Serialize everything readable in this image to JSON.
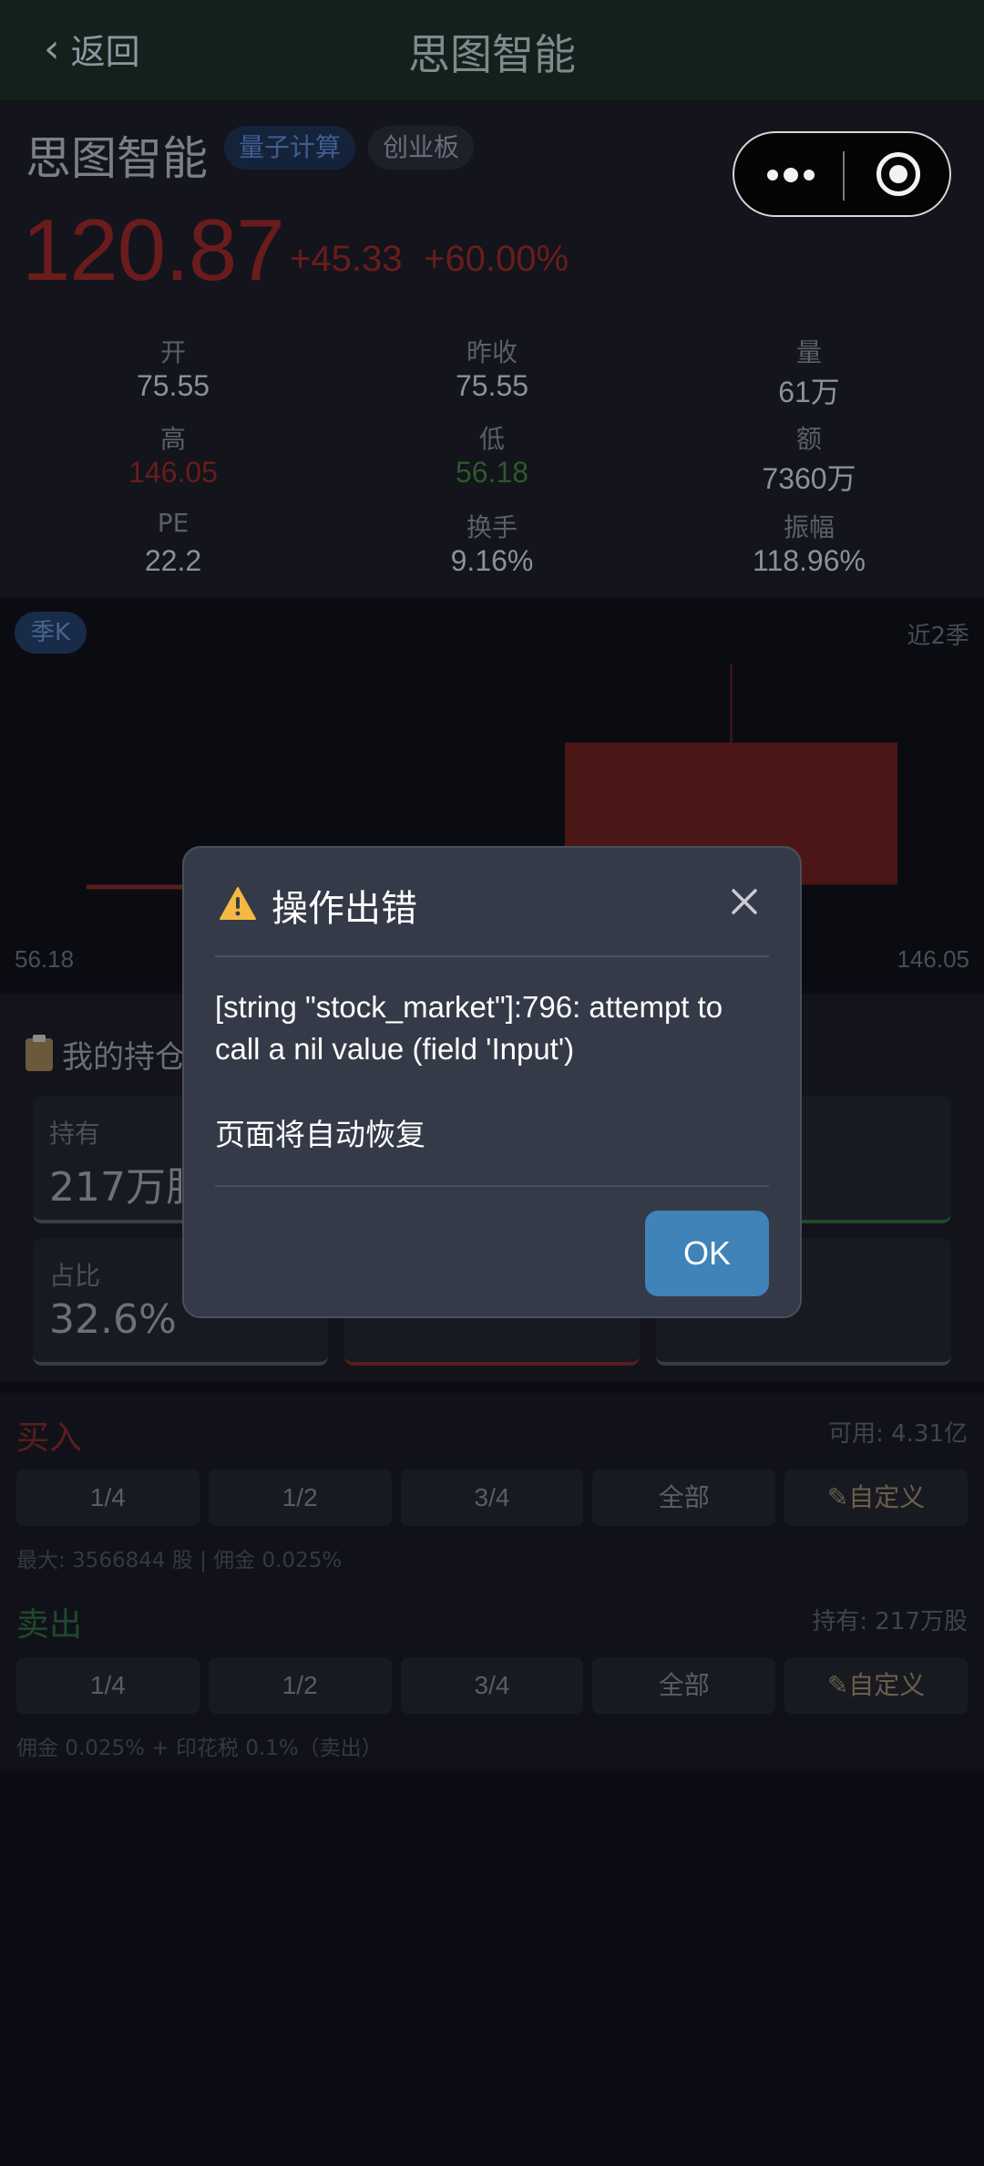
{
  "nav": {
    "back_label": "返回",
    "title": "思图智能"
  },
  "quote": {
    "name": "思图智能",
    "tags": [
      "量子计算",
      "创业板"
    ],
    "price": "120.87",
    "change": "+45.33",
    "change_pct": "+60.00%"
  },
  "stats": {
    "open": {
      "label": "开",
      "value": "75.55"
    },
    "prev_close": {
      "label": "昨收",
      "value": "75.55"
    },
    "volume": {
      "label": "量",
      "value": "61万"
    },
    "high": {
      "label": "高",
      "value": "146.05"
    },
    "low": {
      "label": "低",
      "value": "56.18"
    },
    "amount": {
      "label": "额",
      "value": "7360万"
    },
    "pe": {
      "label": "PE",
      "value": "22.2"
    },
    "turnover": {
      "label": "换手",
      "value": "9.16%"
    },
    "amplitude": {
      "label": "振幅",
      "value": "118.96%"
    }
  },
  "chart": {
    "period_chip": "季K",
    "range_label": "近2季",
    "axis_min": "56.18",
    "axis_max": "146.05"
  },
  "chart_data": {
    "type": "candlestick",
    "ylim": [
      56.18,
      146.05
    ],
    "candles": [
      {
        "open": 75.55,
        "close": 75.55,
        "high": 75.55,
        "low": 75.55
      },
      {
        "open": 75.55,
        "close": 120.87,
        "high": 146.05,
        "low": 56.18
      }
    ]
  },
  "holdings": {
    "title": "我的持仓",
    "cards": [
      {
        "label": "持有",
        "value": "217万股"
      },
      {
        "label": "占比",
        "value": "32.6%"
      }
    ]
  },
  "buy": {
    "title": "买入",
    "available": "可用: 4.31亿",
    "buttons": [
      "1/4",
      "1/2",
      "3/4",
      "全部",
      "✎自定义"
    ],
    "hint": "最大: 3566844 股 | 佣金 0.025%"
  },
  "sell": {
    "title": "卖出",
    "holding": "持有: 217万股",
    "buttons": [
      "1/4",
      "1/2",
      "3/4",
      "全部",
      "✎自定义"
    ],
    "hint": "佣金 0.025% + 印花税 0.1%（卖出）"
  },
  "dialog": {
    "title": "操作出错",
    "message": "[string \"stock_market\"]:796: attempt to call a nil value (field 'Input')",
    "sub": "页面将自动恢复",
    "ok_label": "OK"
  },
  "colors": {
    "dialog_bg": "#353a48",
    "ok_button": "#3f83b8",
    "up": "#6a1c1c",
    "down": "#2b5a2b"
  }
}
